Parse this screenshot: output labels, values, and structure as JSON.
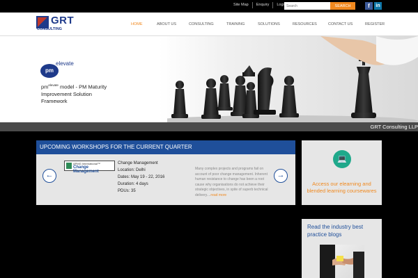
{
  "topbar": {
    "links": [
      "Site Map",
      "Enquiry",
      "Login"
    ],
    "search_placeholder": "Search",
    "search_button": "SEARCH",
    "social": [
      "f",
      "in"
    ]
  },
  "brand": {
    "name": "GRT",
    "sub": "CONSULTING"
  },
  "nav": [
    {
      "label": "HOME",
      "active": true
    },
    {
      "label": "ABOUT US",
      "active": false
    },
    {
      "label": "CONSULTING",
      "active": false
    },
    {
      "label": "TRAINING",
      "active": false
    },
    {
      "label": "SOLUTIONS",
      "active": false
    },
    {
      "label": "RESOURCES",
      "active": false
    },
    {
      "label": "CONTACT US",
      "active": false
    },
    {
      "label": "REGISTER",
      "active": false
    }
  ],
  "colors": {
    "accent": "#f0891f",
    "brand_blue": "#1f4f9a",
    "teal": "#1fa98b"
  },
  "hero": {
    "badge": "pm",
    "elevate": "elevate",
    "pm_prefix": "pm",
    "pm_sup": "elevate",
    "title_rest": " model - PM Maturity Improvement Solution Framework"
  },
  "ticker": "GRT Consulting LLP",
  "workshops": {
    "heading": "UPCOMING WORKSHOPS FOR THE CURRENT QUARTER",
    "logo_top": "APMG International™",
    "logo_main": "Change Management",
    "title": "Change Management",
    "location": "Location: Delhi",
    "dates": "Dates: May 19 - 22, 2016",
    "duration": "Duration: 4 days",
    "pdus": "PDUs: 35",
    "description": "Many complex projects and programs fail on account of poor change management. Inherent human resistance to change has been a root cause why organisations do not achieve their strategic objectives, in spite of superb technical delivery....",
    "read_more": "read more"
  },
  "elearning": {
    "text": "Access our elearning and blended learning coursewares"
  },
  "blogs": {
    "text": "Read the industry best practice blogs"
  }
}
